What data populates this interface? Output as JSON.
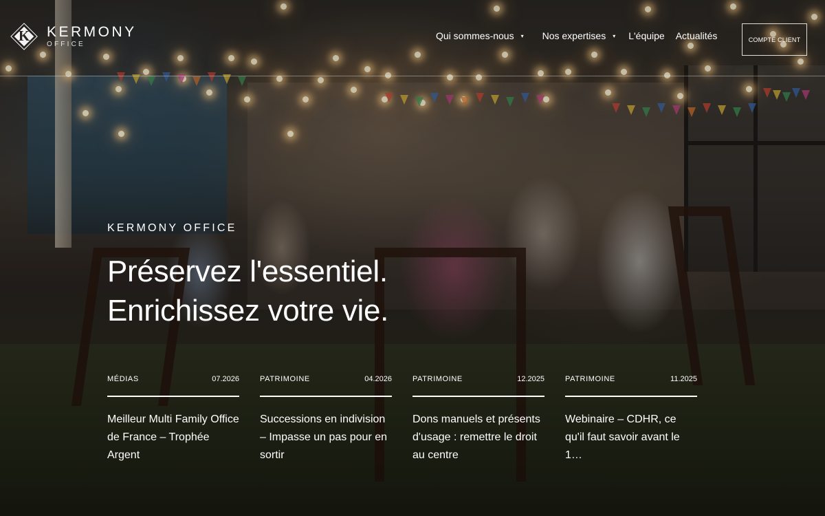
{
  "brand": {
    "mark_letter": "K",
    "name": "KERMONY",
    "subtitle": "OFFICE"
  },
  "nav": {
    "items": [
      {
        "label": "Qui sommes-nous",
        "has_dropdown": true,
        "caret": "▾"
      },
      {
        "label": "Nos expertises",
        "has_dropdown": true,
        "caret": "▾"
      },
      {
        "label": "L'équipe",
        "has_dropdown": false
      },
      {
        "label": "Actualités",
        "has_dropdown": false
      }
    ],
    "client_button": "COMPTE CLIENT"
  },
  "hero": {
    "eyebrow": "KERMONY OFFICE",
    "headline_line1": "Préservez l'essentiel.",
    "headline_line2": "Enrichissez votre vie."
  },
  "news": [
    {
      "category": "MÉDIAS",
      "date": "07.2026",
      "title": "Meilleur Multi Family Office de France – Trophée Argent"
    },
    {
      "category": "PATRIMOINE",
      "date": "04.2026",
      "title": "Successions en indivision – Impasse un pas pour en sortir"
    },
    {
      "category": "PATRIMOINE",
      "date": "12.2025",
      "title": "Dons manuels et présents d'usage : remettre le droit au centre"
    },
    {
      "category": "PATRIMOINE",
      "date": "11.2025",
      "title": "Webinaire – CDHR, ce qu'il faut savoir avant le 1…"
    }
  ],
  "colors": {
    "text": "#ffffff",
    "bulb_glow": "#ffd28c"
  }
}
